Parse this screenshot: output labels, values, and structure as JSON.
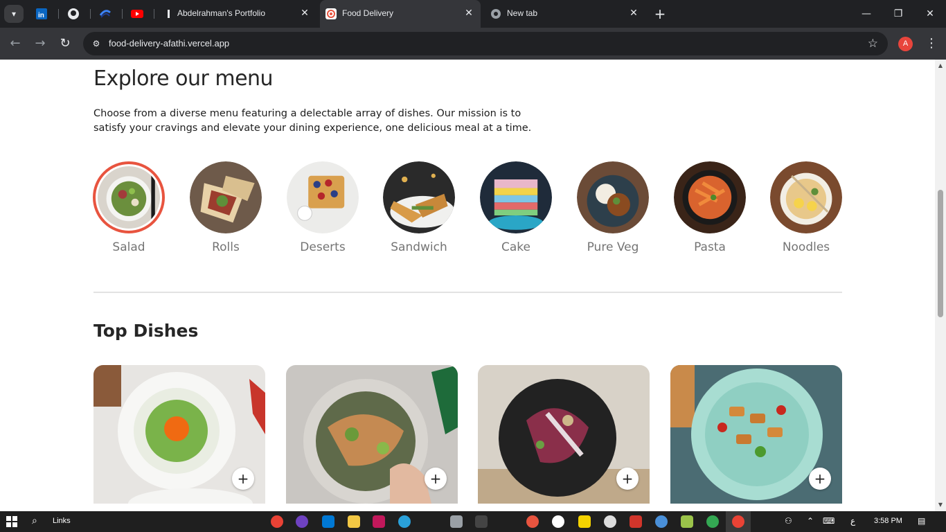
{
  "browser": {
    "tabs": [
      {
        "title": "Abdelrahman's Portfolio",
        "active": false
      },
      {
        "title": "Food Delivery",
        "active": true
      },
      {
        "title": "New tab",
        "active": false
      }
    ],
    "url": "food-delivery-afathi.vercel.app",
    "profile_initial": "A",
    "pinned_icons": [
      "linkedin-icon",
      "github-icon",
      "codeforces-icon",
      "youtube-icon"
    ]
  },
  "menu": {
    "title": "Explore our menu",
    "description": "Choose from a diverse menu featuring a delectable array of dishes. Our mission is to satisfy your cravings and elevate your dining experience, one delicious meal at a time.",
    "categories": [
      {
        "label": "Salad",
        "active": true
      },
      {
        "label": "Rolls",
        "active": false
      },
      {
        "label": "Deserts",
        "active": false
      },
      {
        "label": "Sandwich",
        "active": false
      },
      {
        "label": "Cake",
        "active": false
      },
      {
        "label": "Pure Veg",
        "active": false
      },
      {
        "label": "Pasta",
        "active": false
      },
      {
        "label": "Noodles",
        "active": false
      }
    ]
  },
  "top_dishes": {
    "title": "Top Dishes",
    "add_label": "+"
  },
  "taskbar": {
    "links_label": "Links",
    "time": "3:58 PM",
    "lang": "ع"
  },
  "colors": {
    "accent": "#e8543f",
    "chrome_dark": "#202124",
    "chrome_mid": "#35363a"
  }
}
